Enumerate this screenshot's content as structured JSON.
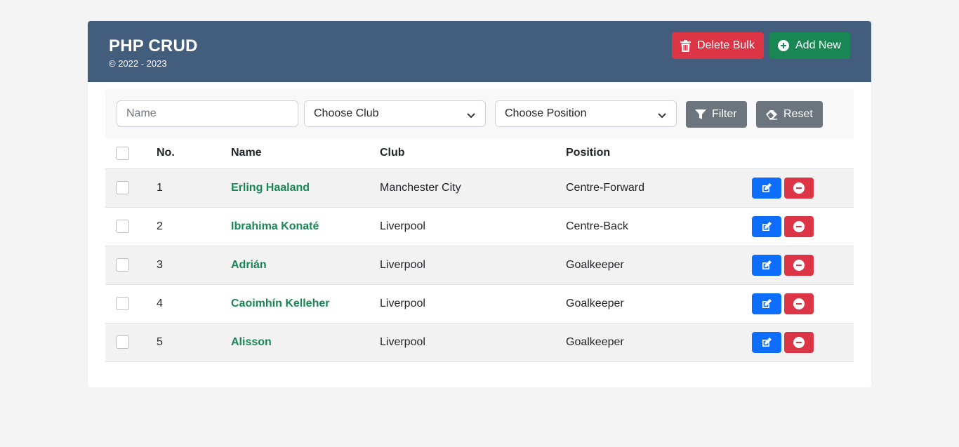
{
  "header": {
    "title": "PHP CRUD",
    "subtitle": "© 2022 - 2023",
    "delete_bulk_label": "Delete Bulk",
    "add_new_label": "Add New"
  },
  "filters": {
    "name_placeholder": "Name",
    "club_select": "Choose Club",
    "position_select": "Choose Position",
    "filter_label": "Filter",
    "reset_label": "Reset"
  },
  "table": {
    "columns": [
      "No.",
      "Name",
      "Club",
      "Position"
    ],
    "rows": [
      {
        "no": "1",
        "name": "Erling Haaland",
        "club": "Manchester City",
        "position": "Centre-Forward"
      },
      {
        "no": "2",
        "name": "Ibrahima Konaté",
        "club": "Liverpool",
        "position": "Centre-Back"
      },
      {
        "no": "3",
        "name": "Adrián",
        "club": "Liverpool",
        "position": "Goalkeeper"
      },
      {
        "no": "4",
        "name": "Caoimhín Kelleher",
        "club": "Liverpool",
        "position": "Goalkeeper"
      },
      {
        "no": "5",
        "name": "Alisson",
        "club": "Liverpool",
        "position": "Goalkeeper"
      }
    ]
  },
  "colors": {
    "header_bg": "#435d7d",
    "danger": "#dc3545",
    "success": "#198754",
    "primary": "#0d6efd",
    "secondary": "#6c757d"
  },
  "icons": {
    "delete_bulk": "trash-icon",
    "add_new": "plus-circle-icon",
    "filter": "filter-icon",
    "reset": "eraser-icon",
    "edit": "edit-icon",
    "remove": "minus-circle-icon",
    "select": "chevron-down-icon"
  }
}
